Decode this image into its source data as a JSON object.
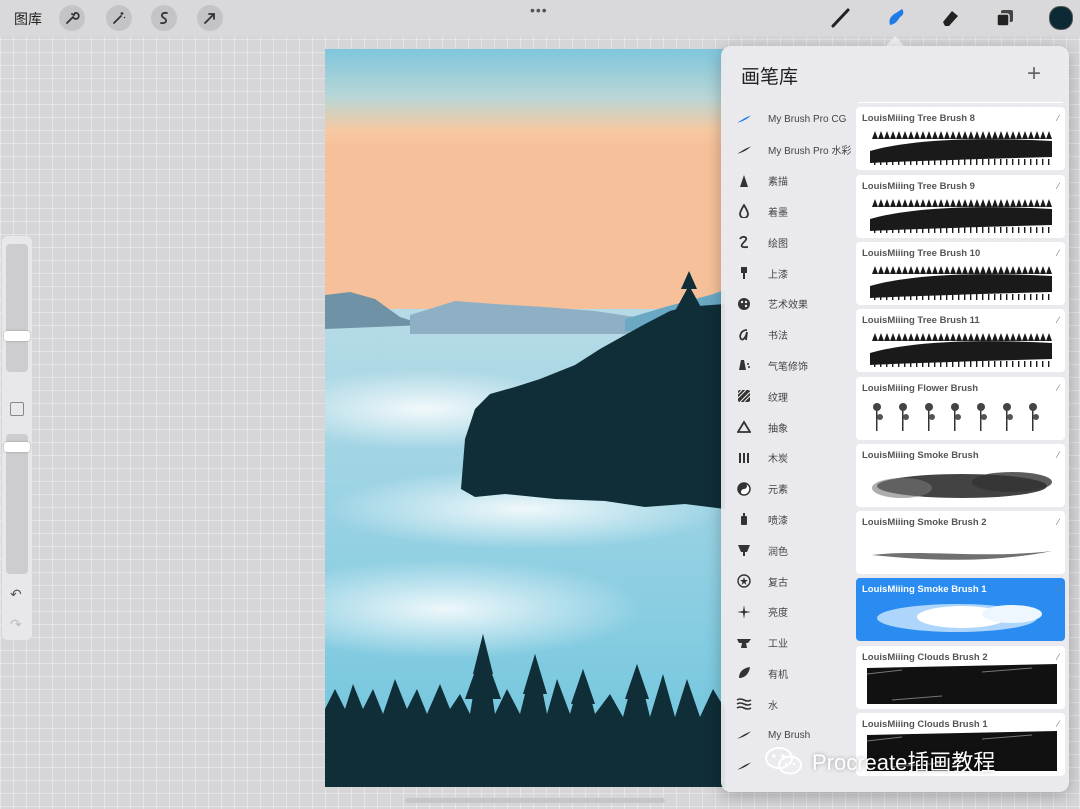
{
  "topbar": {
    "gallery_label": "图库",
    "left_tools": [
      "wrench-icon",
      "magic-wand-icon",
      "selection-icon",
      "transform-arrow-icon"
    ],
    "more_dots": "•••",
    "right_tools": [
      "brush-icon",
      "smudge-icon",
      "eraser-icon",
      "layers-icon"
    ],
    "active_tool": "smudge-icon",
    "current_color": "#0b2a33"
  },
  "sidebar": {
    "undo_symbol": "↶",
    "redo_symbol": "↷"
  },
  "panel": {
    "title": "画笔库",
    "add_symbol": "+",
    "sets": [
      {
        "label": "My Brush Pro CG",
        "icon": "brush-stroke-icon",
        "active": true
      },
      {
        "label": "My Brush Pro 水彩",
        "icon": "brush-stroke-icon"
      },
      {
        "label": "素描",
        "icon": "pencil-tip-icon"
      },
      {
        "label": "着墨",
        "icon": "ink-drop-icon"
      },
      {
        "label": "绘图",
        "icon": "squiggle-icon"
      },
      {
        "label": "上漆",
        "icon": "paint-brush-icon"
      },
      {
        "label": "艺术效果",
        "icon": "palette-icon"
      },
      {
        "label": "书法",
        "icon": "calligraphy-icon"
      },
      {
        "label": "气笔修饰",
        "icon": "airbrush-icon"
      },
      {
        "label": "纹理",
        "icon": "texture-icon"
      },
      {
        "label": "抽象",
        "icon": "triangle-icon"
      },
      {
        "label": "木炭",
        "icon": "charcoal-icon"
      },
      {
        "label": "元素",
        "icon": "yin-yang-icon"
      },
      {
        "label": "喷漆",
        "icon": "spray-can-icon"
      },
      {
        "label": "润色",
        "icon": "touchup-icon"
      },
      {
        "label": "复古",
        "icon": "retro-star-icon"
      },
      {
        "label": "亮度",
        "icon": "sparkle-icon"
      },
      {
        "label": "工业",
        "icon": "anvil-icon"
      },
      {
        "label": "有机",
        "icon": "leaf-icon"
      },
      {
        "label": "水",
        "icon": "waves-icon"
      },
      {
        "label": "My Brush",
        "icon": "brush-stroke-icon"
      },
      {
        "label": "",
        "icon": "brush-stroke-icon"
      }
    ],
    "brushes": [
      {
        "name": "",
        "stroke": "tree",
        "selected": false
      },
      {
        "name": "LouisMiiing Tree Brush 8",
        "stroke": "tree",
        "selected": false
      },
      {
        "name": "LouisMiiing Tree Brush 9",
        "stroke": "tree",
        "selected": false
      },
      {
        "name": "LouisMiiing Tree Brush 10",
        "stroke": "forest",
        "selected": false
      },
      {
        "name": "LouisMiiing Tree Brush 11",
        "stroke": "tree",
        "selected": false
      },
      {
        "name": "LouisMiiing Flower Brush",
        "stroke": "flower",
        "selected": false
      },
      {
        "name": "LouisMiiing Smoke Brush",
        "stroke": "smoke",
        "selected": false
      },
      {
        "name": "LouisMiiing Smoke Brush 2",
        "stroke": "wisp",
        "selected": false
      },
      {
        "name": "LouisMiiing Smoke Brush 1",
        "stroke": "cloud",
        "selected": true
      },
      {
        "name": "LouisMiiing Clouds Brush 2",
        "stroke": "dark",
        "selected": false
      },
      {
        "name": "LouisMiiing Clouds Brush 1",
        "stroke": "dark",
        "selected": false
      }
    ]
  },
  "watermark": {
    "text": "Procreate插画教程"
  }
}
